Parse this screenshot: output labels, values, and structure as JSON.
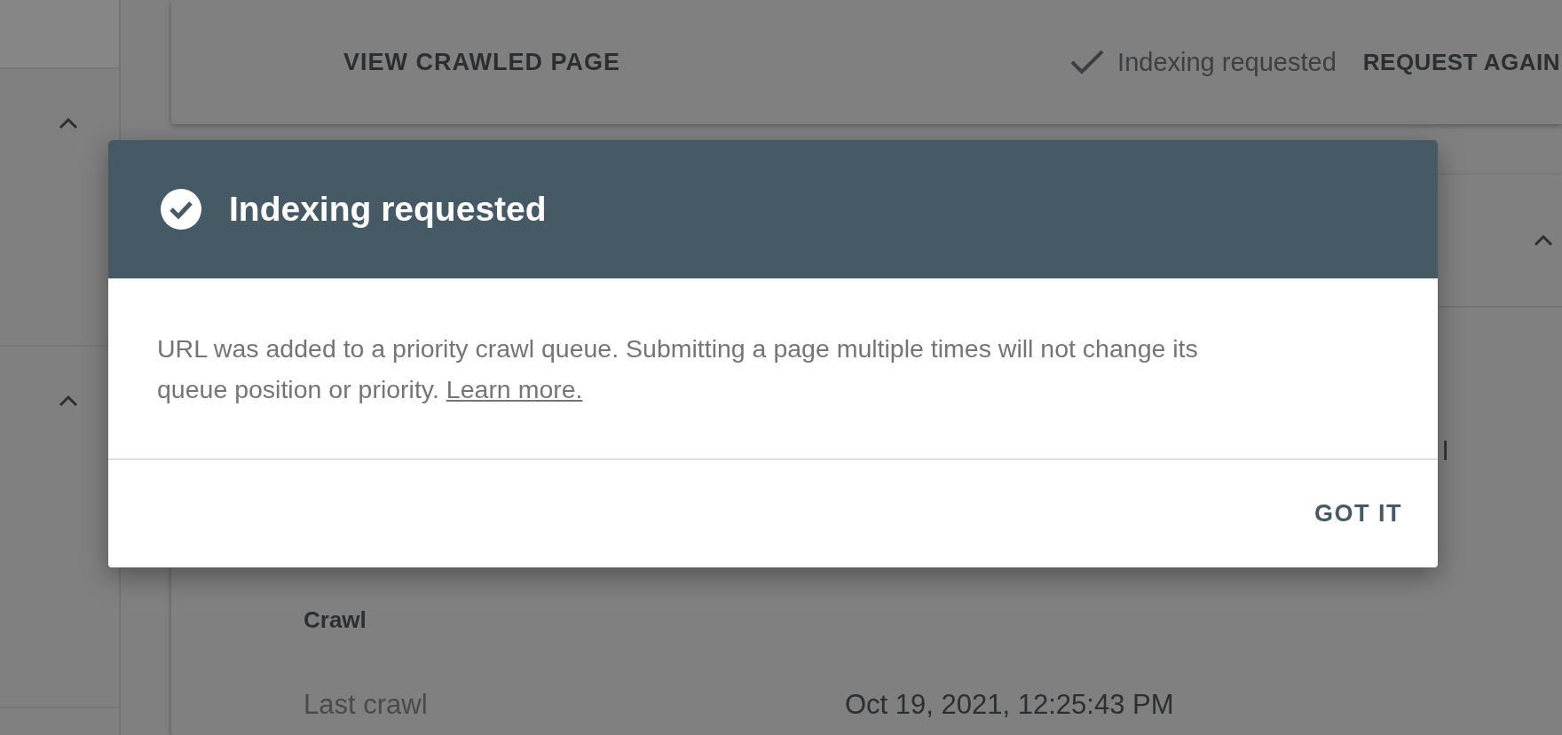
{
  "sidebar": {
    "sections": [
      {
        "expanded": true
      },
      {
        "expanded": true
      }
    ]
  },
  "top_card": {
    "view_button": "VIEW CRAWLED PAGE",
    "status": "Indexing requested",
    "request_button": "REQUEST AGAIN"
  },
  "details_card": {
    "expanded": true,
    "partial_text": "l",
    "section_title": "Crawl",
    "rows": [
      {
        "label": "Last crawl",
        "value": "Oct 19, 2021, 12:25:43 PM"
      }
    ]
  },
  "dialog": {
    "title": "Indexing requested",
    "message": "URL was added to a priority crawl queue. Submitting a page multiple times will not change its queue position or priority.",
    "link": "Learn more.",
    "button": "GOT IT"
  }
}
